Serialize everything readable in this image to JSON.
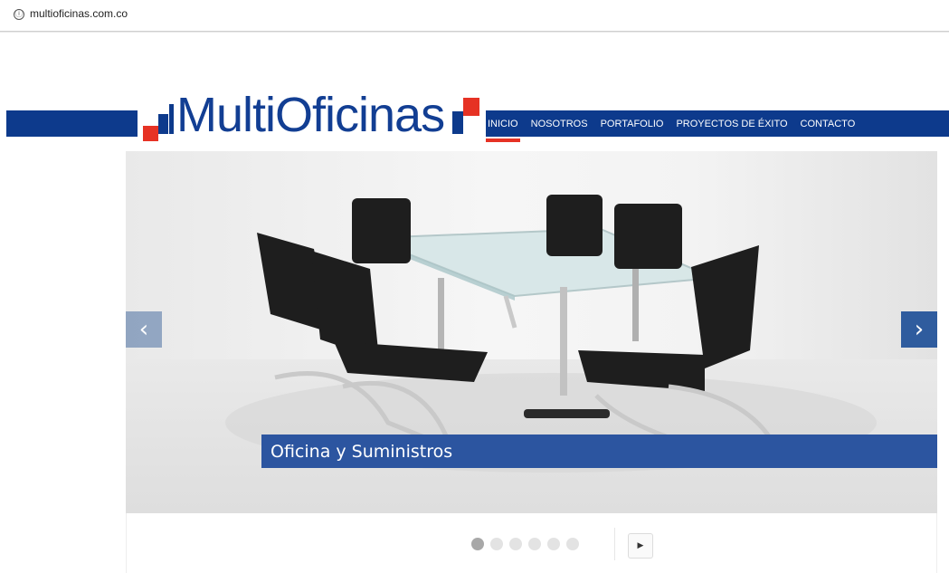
{
  "browser": {
    "info_icon": "ⓘ",
    "url": "multioficinas.com.co"
  },
  "brand": {
    "logo_text": "MultiOficinas",
    "primary_color": "#0d3a8c",
    "accent_color": "#e63224"
  },
  "nav": {
    "items": [
      {
        "label": "INICIO",
        "active": true
      },
      {
        "label": "NOSOTROS"
      },
      {
        "label": "PORTAFOLIO"
      },
      {
        "label": "PROYECTOS DE ÉXITO"
      },
      {
        "label": "CONTACTO"
      }
    ]
  },
  "slider": {
    "caption": "Oficina y Suministros",
    "prev_icon": "chevron-left-icon",
    "next_icon": "chevron-right-icon",
    "prev_glyph": "‹",
    "next_glyph": "›",
    "slide_count": 6,
    "active_slide": 1,
    "play_glyph": "▶"
  }
}
